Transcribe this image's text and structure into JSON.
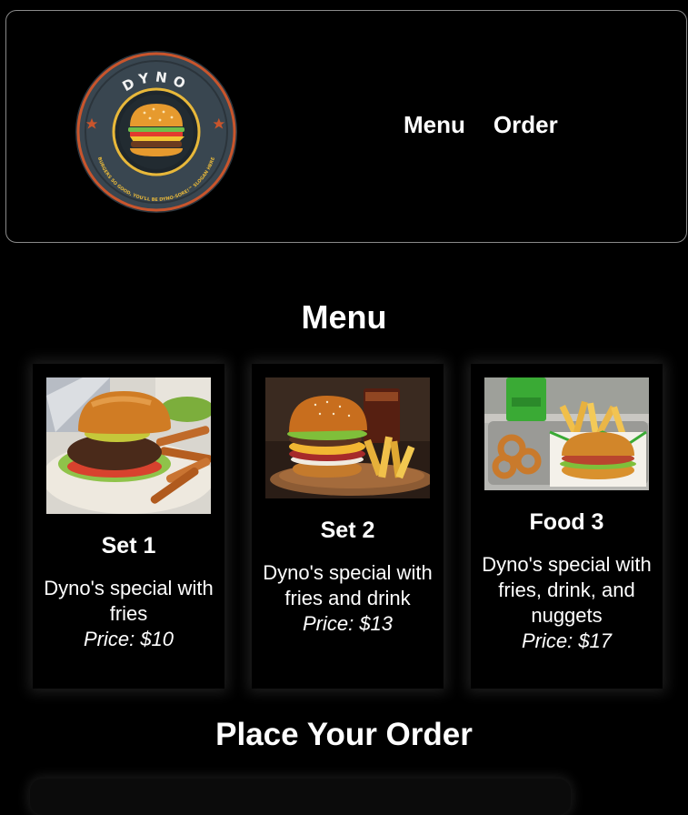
{
  "header": {
    "logo_text": "DYNO",
    "logo_slogan": "BURGERS SO GOOD, YOU'LL BE DYNO-SORE!™ SLOGAN HERE",
    "nav": [
      "Menu",
      "Order"
    ]
  },
  "menu": {
    "title": "Menu",
    "items": [
      {
        "name": "Set 1",
        "desc": "Dyno's special with fries",
        "price": "Price: $10",
        "image": "burger-fries-photo"
      },
      {
        "name": "Set 2",
        "desc": "Dyno's special with fries and drink",
        "price": "Price: $13",
        "image": "burger-fries-drink-photo"
      },
      {
        "name": "Food 3",
        "desc": "Dyno's special with fries, drink, and nuggets",
        "price": "Price: $17",
        "image": "burger-tray-photo"
      }
    ]
  },
  "order": {
    "title": "Place Your Order"
  },
  "colors": {
    "background": "#000000",
    "text": "#ffffff",
    "logo_ring": "#c9552c",
    "logo_bg": "#394650",
    "logo_accent": "#e8b83a"
  }
}
